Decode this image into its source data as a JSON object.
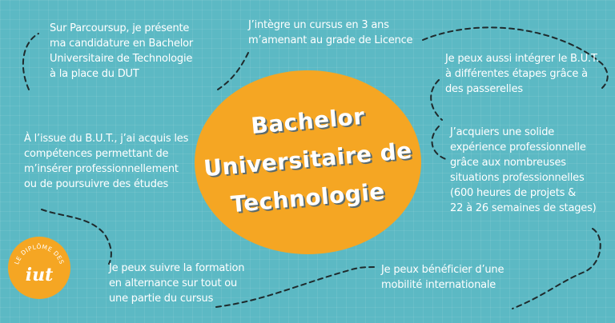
{
  "title": {
    "line1": "Bachelor",
    "line2": "Universitaire de",
    "line3": "Technologie"
  },
  "notes": {
    "parcoursup": [
      "Sur Parcoursup, je présente",
      "ma candidature en Bachelor",
      "Universitaire de Technologie",
      "à la place du DUT"
    ],
    "licence": [
      "J’intègre un cursus en 3 ans",
      "m’amenant au grade de Licence"
    ],
    "passerelles": [
      "Je peux aussi intégrer le B.U.T.",
      "à différentes étapes grâce à",
      "des passerelles"
    ],
    "competences": [
      "À l’issue du B.U.T., j’ai acquis les",
      "compétences permettant de",
      "m’insérer professionnellement",
      "ou de poursuivre des études"
    ],
    "experience": [
      "J’acquiers une solide",
      "expérience professionnelle",
      "grâce aux nombreuses",
      "situations professionnelles",
      "(600 heures de projets &",
      "22 à 26 semaines de stages)"
    ],
    "alternance": [
      "Je peux suivre la formation",
      "en alternance sur tout ou",
      "une partie du cursus"
    ],
    "mobilite": [
      "Je peux bénéficier d’une",
      "mobilité internationale"
    ]
  },
  "badge": {
    "arc_text": "LE DIPLÔME DES",
    "logo": "iut"
  },
  "colors": {
    "background": "#5cb9c4",
    "accent": "#f5a623",
    "text": "#ffffff",
    "dash": "#1e2a2c"
  }
}
